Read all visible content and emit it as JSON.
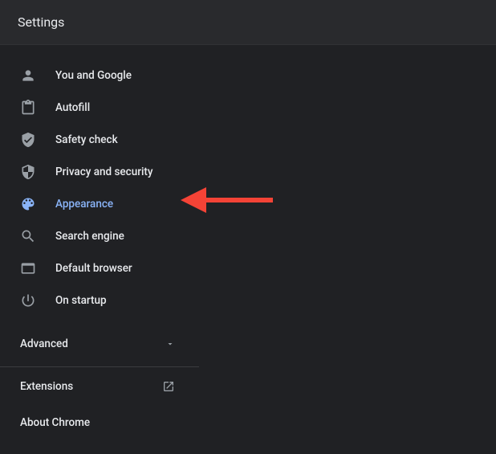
{
  "header": {
    "title": "Settings"
  },
  "sidebar": {
    "items": [
      {
        "label": "You and Google"
      },
      {
        "label": "Autofill"
      },
      {
        "label": "Safety check"
      },
      {
        "label": "Privacy and security"
      },
      {
        "label": "Appearance",
        "active": true
      },
      {
        "label": "Search engine"
      },
      {
        "label": "Default browser"
      },
      {
        "label": "On startup"
      }
    ],
    "advanced_label": "Advanced",
    "extensions_label": "Extensions",
    "about_label": "About Chrome"
  },
  "colors": {
    "accent": "#8ab4f8",
    "annotation": "#f44336"
  }
}
